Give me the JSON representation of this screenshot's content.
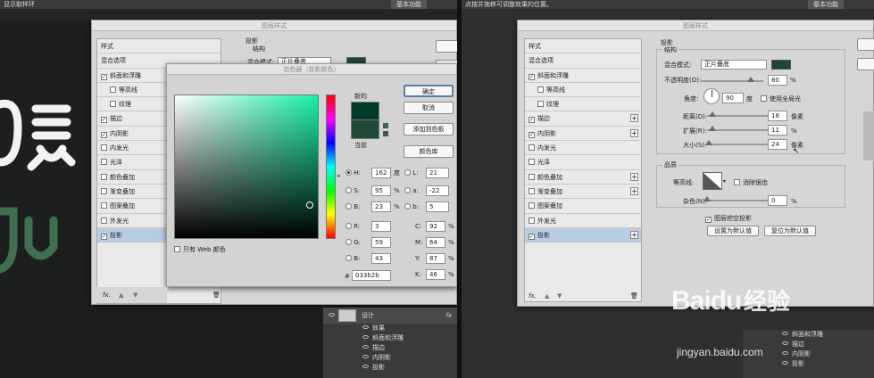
{
  "left": {
    "topbar": {
      "text": "显示取样环",
      "workspace": "基本功能"
    },
    "layer_style": {
      "title": "图层样式",
      "section": "投影",
      "structure": "结构",
      "blend_label": "混合模式:",
      "blend_value": "正片叠底"
    },
    "style_list": [
      {
        "label": "样式",
        "check": false,
        "has_cb": false,
        "indent": false
      },
      {
        "label": "混合选项",
        "check": false,
        "has_cb": false,
        "indent": false
      },
      {
        "label": "斜面和浮雕",
        "check": true,
        "has_cb": true,
        "indent": false
      },
      {
        "label": "等高线",
        "check": false,
        "has_cb": true,
        "indent": true
      },
      {
        "label": "纹理",
        "check": false,
        "has_cb": true,
        "indent": true
      },
      {
        "label": "描边",
        "check": true,
        "has_cb": true,
        "indent": false
      },
      {
        "label": "内阴影",
        "check": true,
        "has_cb": true,
        "indent": false
      },
      {
        "label": "内发光",
        "check": false,
        "has_cb": true,
        "indent": false
      },
      {
        "label": "光泽",
        "check": false,
        "has_cb": true,
        "indent": false
      },
      {
        "label": "颜色叠加",
        "check": false,
        "has_cb": true,
        "indent": false
      },
      {
        "label": "渐变叠加",
        "check": false,
        "has_cb": true,
        "indent": false
      },
      {
        "label": "图案叠加",
        "check": false,
        "has_cb": true,
        "indent": false
      },
      {
        "label": "外发光",
        "check": false,
        "has_cb": true,
        "indent": false
      },
      {
        "label": "投影",
        "check": true,
        "has_cb": true,
        "indent": false,
        "selected": true
      }
    ],
    "fx_label": "fx.",
    "picker": {
      "title": "拾色器（投影颜色）",
      "new_label": "新的",
      "current_label": "当前",
      "ok": "确定",
      "cancel": "取消",
      "add_swatch": "添加到色板",
      "library": "颜色库",
      "web_only": "只有 Web 颜色",
      "h_label": "H:",
      "h_value": "162",
      "h_unit": "度",
      "s_label": "S:",
      "s_value": "95",
      "s_unit": "%",
      "b_label": "B:",
      "b_value": "23",
      "b_unit": "%",
      "r_label": "R:",
      "r_value": "3",
      "g_label": "G:",
      "g_value": "59",
      "bb_label": "B:",
      "bb_value": "43",
      "l_label": "L:",
      "l_value": "21",
      "a_label": "a:",
      "a_value": "-22",
      "lb_label": "b:",
      "lb_value": "5",
      "c_label": "C:",
      "c_value": "92",
      "m_label": "M:",
      "m_value": "64",
      "y_label": "Y:",
      "y_value": "87",
      "k_label": "K:",
      "k_value": "46",
      "pct": "%",
      "hex_label": "#",
      "hex_value": "033b2b"
    },
    "layers": [
      {
        "label": "设计",
        "fx": "fx"
      },
      {
        "label": "效果"
      },
      {
        "label": "斜面和浮雕"
      },
      {
        "label": "描边"
      },
      {
        "label": "内阴影"
      },
      {
        "label": "投影"
      }
    ]
  },
  "right": {
    "topbar": {
      "text": "点按并拖移可调整效果的位置。",
      "workspace": "基本功能"
    },
    "layer_style": {
      "title": "图层样式",
      "section": "投影",
      "structure": "结构",
      "blend_label": "混合模式:",
      "blend_value": "正片叠底",
      "opacity_label": "不透明度(O):",
      "opacity_value": "80",
      "angle_label": "角度:",
      "angle_value": "90",
      "angle_unit": "度",
      "global_light": "使用全局光",
      "distance_label": "距离(D):",
      "distance_value": "18",
      "spread_label": "扩展(R):",
      "spread_value": "11",
      "size_label": "大小(S):",
      "size_value": "24",
      "px": "像素",
      "pct": "%",
      "quality": "品质",
      "contour_label": "等高线:",
      "antialias": "消除锯齿",
      "noise_label": "杂色(N):",
      "noise_value": "0",
      "knockout": "图层挖空投影",
      "set_default": "设置为默认值",
      "reset_default": "复位为默认值"
    },
    "style_list": [
      {
        "label": "样式",
        "check": false,
        "has_cb": false,
        "indent": false,
        "plus": false
      },
      {
        "label": "混合选项",
        "check": false,
        "has_cb": false,
        "indent": false,
        "plus": false
      },
      {
        "label": "斜面和浮雕",
        "check": true,
        "has_cb": true,
        "indent": false,
        "plus": false
      },
      {
        "label": "等高线",
        "check": false,
        "has_cb": true,
        "indent": true,
        "plus": false
      },
      {
        "label": "纹理",
        "check": false,
        "has_cb": true,
        "indent": true,
        "plus": false
      },
      {
        "label": "描边",
        "check": true,
        "has_cb": true,
        "indent": false,
        "plus": true
      },
      {
        "label": "内阴影",
        "check": true,
        "has_cb": true,
        "indent": false,
        "plus": true
      },
      {
        "label": "内发光",
        "check": false,
        "has_cb": true,
        "indent": false,
        "plus": false
      },
      {
        "label": "光泽",
        "check": false,
        "has_cb": true,
        "indent": false,
        "plus": false
      },
      {
        "label": "颜色叠加",
        "check": false,
        "has_cb": true,
        "indent": false,
        "plus": true
      },
      {
        "label": "渐变叠加",
        "check": false,
        "has_cb": true,
        "indent": false,
        "plus": true
      },
      {
        "label": "图案叠加",
        "check": false,
        "has_cb": true,
        "indent": false,
        "plus": false
      },
      {
        "label": "外发光",
        "check": false,
        "has_cb": true,
        "indent": false,
        "plus": false
      },
      {
        "label": "投影",
        "check": true,
        "has_cb": true,
        "indent": false,
        "plus": true,
        "selected": true
      }
    ],
    "fx_label": "fx.",
    "layers": [
      {
        "label": "斜面和浮雕"
      },
      {
        "label": "描边"
      },
      {
        "label": "内阴影"
      },
      {
        "label": "投影"
      }
    ]
  },
  "watermark": {
    "brand": "Baidu",
    "cn": "经验",
    "url": "jingyan.baidu.com"
  },
  "colors": {
    "picked": "#033b2b",
    "selected_row": "#b9cde2",
    "dialog": "#d6d6d6"
  }
}
